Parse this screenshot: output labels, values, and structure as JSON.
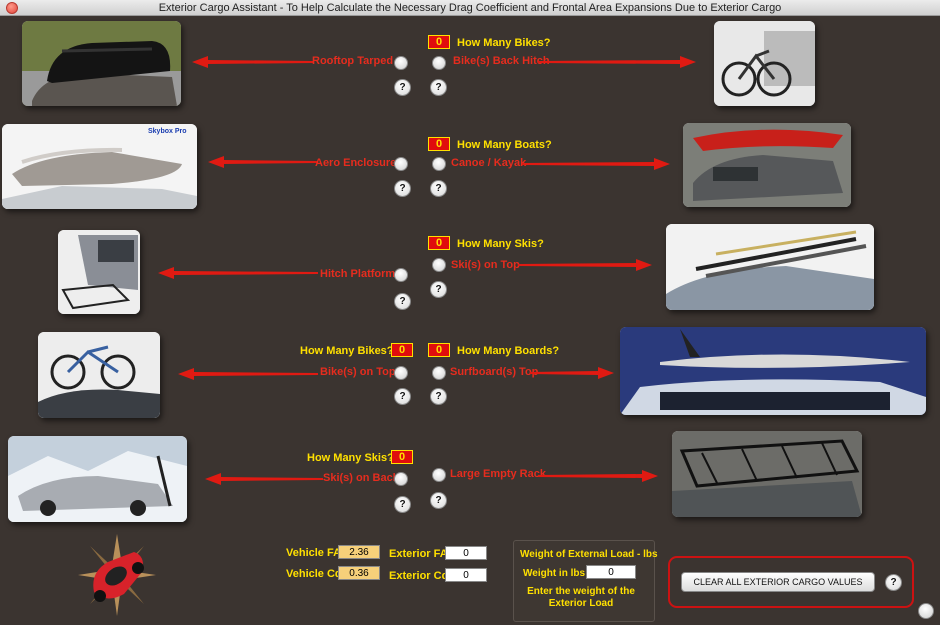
{
  "window": {
    "title": "Exterior Cargo Assistant - To Help Calculate the Necessary Drag Coefficient and Frontal Area Expansions Due to Exterior Cargo"
  },
  "labels": {
    "rooftop_tarped": "Rooftop Tarped",
    "bikes_back_hitch": "Bike(s) Back Hitch",
    "aero_enclosure": "Aero Enclosure",
    "canoe_kayak": "Canoe / Kayak",
    "hitch_platform": "Hitch Platform",
    "skis_on_top": "Ski(s) on Top",
    "bikes_on_top": "Bike(s) on Top",
    "surfboards_top": "Surfboard(s) Top",
    "skis_on_back": "Ski(s) on Back",
    "large_empty_rack": "Large Empty Rack"
  },
  "questions": {
    "bikes_hitch": "How Many Bikes?",
    "boats": "How Many Boats?",
    "skis_top": "How Many Skis?",
    "bikes_top": "How Many Bikes?",
    "boards": "How Many Boards?",
    "skis_back": "How Many Skis?"
  },
  "counts": {
    "bikes_hitch": "0",
    "boats": "0",
    "skis_top": "0",
    "bikes_top": "0",
    "boards": "0",
    "skis_back": "0"
  },
  "photo_text": {
    "skybox": "Skybox Pro"
  },
  "help_symbol": "?",
  "bottom": {
    "vehicle_fa_label": "Vehicle FA",
    "vehicle_fa_value": "2.36",
    "vehicle_cd_label": "Vehicle Cd",
    "vehicle_cd_value": "0.36",
    "exterior_fa_label": "Exterior FA",
    "exterior_fa_value": "0",
    "exterior_cd_label": "Exterior Cd",
    "exterior_cd_value": "0"
  },
  "weight_panel": {
    "title": "Weight of External Load - lbs",
    "field_label": "Weight in lbs",
    "field_value": "0",
    "instruction": "Enter the weight of the Exterior Load"
  },
  "clear_button": "CLEAR ALL EXTERIOR CARGO VALUES",
  "colors": {
    "background": "#3b3430",
    "label_red": "#e62c1e",
    "label_yellow": "#ffe000",
    "counter_bg": "#e00d0d"
  },
  "icons": [
    "help-icon",
    "radio-button",
    "red-arrow",
    "compass-car-logo"
  ]
}
